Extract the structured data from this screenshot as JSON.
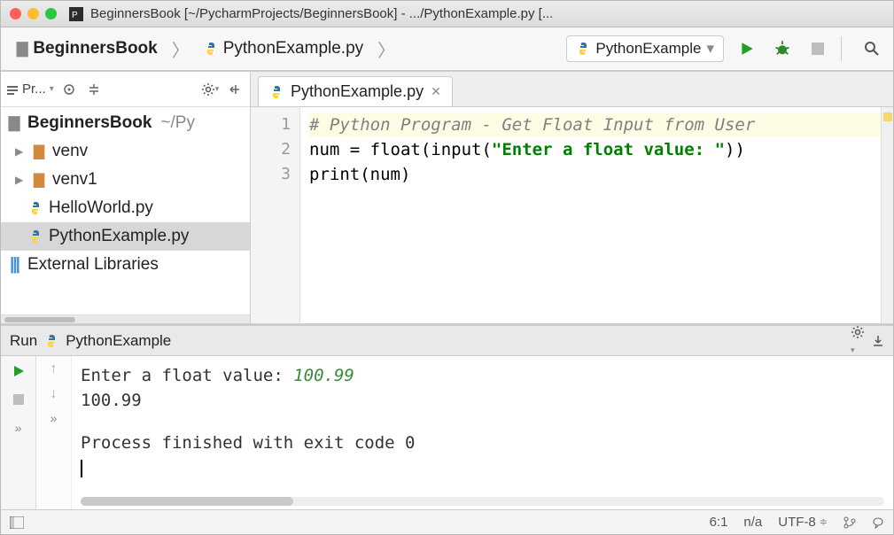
{
  "title": "BeginnersBook [~/PycharmProjects/BeginnersBook] - .../PythonExample.py [...",
  "breadcrumb": {
    "project": "BeginnersBook",
    "file": "PythonExample.py"
  },
  "run_config": {
    "label": "PythonExample"
  },
  "sidebar": {
    "toolbar_label": "Pr...",
    "root": {
      "name": "BeginnersBook",
      "path": "~/Py"
    },
    "items": [
      {
        "label": "venv"
      },
      {
        "label": "venv1"
      },
      {
        "label": "HelloWorld.py"
      },
      {
        "label": "PythonExample.py"
      }
    ],
    "external_label": "External Libraries"
  },
  "editor": {
    "tab": "PythonExample.py",
    "line_numbers": [
      "1",
      "2",
      "3"
    ],
    "code": {
      "l1_comment": "# Python Program - Get Float Input from User",
      "l2_pre": "num = float(input(",
      "l2_str": "\"Enter a float value: \"",
      "l2_post": "))",
      "l3": "print(num)"
    }
  },
  "run": {
    "title_prefix": "Run",
    "title": "PythonExample",
    "out_prompt": "Enter a float value: ",
    "out_input": "100.99",
    "out_echo": "100.99",
    "out_exit": "Process finished with exit code 0"
  },
  "status": {
    "pos": "6:1",
    "inspect": "n/a",
    "enc": "UTF-8"
  }
}
